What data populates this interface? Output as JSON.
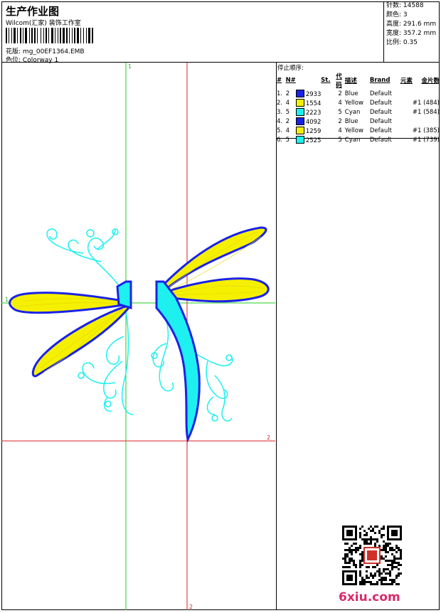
{
  "header": {
    "title": "生产作业图",
    "company": "Wilcom(汇家) 装饰工作室",
    "design_label": "花版:",
    "design_value": "mg_00EF1364.EMB",
    "colorway_label": "色位:",
    "colorway_value": "Colorway 1"
  },
  "stats": [
    {
      "label": "针数:",
      "value": "14588"
    },
    {
      "label": "颜色:",
      "value": "3"
    },
    {
      "label": "高度:",
      "value": "291.6 mm"
    },
    {
      "label": "宽度:",
      "value": "357.2 mm"
    },
    {
      "label": "比例:",
      "value": "0.35"
    }
  ],
  "stop_sequence": {
    "caption": "停止顺序:",
    "headers": [
      "#",
      "N#",
      "St.",
      "代码",
      "描述",
      "Brand",
      "元素",
      "金片数"
    ],
    "rows": [
      {
        "num": "1.",
        "n": "2",
        "color": "#1a22e6",
        "st": "2933",
        "code": "2",
        "desc": "Blue",
        "brand": "Default",
        "elem": "",
        "seq": ""
      },
      {
        "num": "2.",
        "n": "4",
        "color": "#f5f000",
        "st": "1554",
        "code": "4",
        "desc": "Yellow",
        "brand": "Default",
        "elem": "",
        "seq": "#1 (484)"
      },
      {
        "num": "3.",
        "n": "5",
        "color": "#1ef0f0",
        "st": "2223",
        "code": "5",
        "desc": "Cyan",
        "brand": "Default",
        "elem": "",
        "seq": "#1 (584)"
      },
      {
        "num": "4.",
        "n": "2",
        "color": "#1a22e6",
        "st": "4092",
        "code": "2",
        "desc": "Blue",
        "brand": "Default",
        "elem": "",
        "seq": ""
      },
      {
        "num": "5.",
        "n": "4",
        "color": "#f5f000",
        "st": "1259",
        "code": "4",
        "desc": "Yellow",
        "brand": "Default",
        "elem": "",
        "seq": "#1 (385)"
      },
      {
        "num": "6.",
        "n": "5",
        "color": "#1ef0f0",
        "st": "2525",
        "code": "5",
        "desc": "Cyan",
        "brand": "Default",
        "elem": "",
        "seq": "#1 (739)"
      }
    ]
  },
  "axes": {
    "green_label": "1",
    "red_label": "2"
  },
  "watermark": "6xiu.com",
  "colors": {
    "blue": "#1a22e6",
    "yellow": "#f5f000",
    "cyan": "#1ef0f0",
    "green_axis": "#22cc22",
    "red_axis": "#dd2222"
  }
}
